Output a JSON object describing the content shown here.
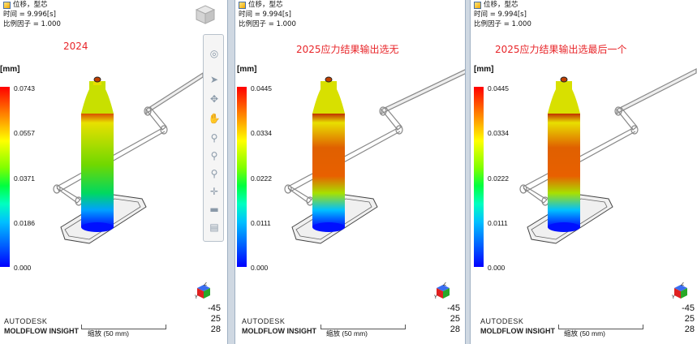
{
  "panels": [
    {
      "header": {
        "line1": "位移，型芯",
        "line2": "时间 = 9.996[s]",
        "line3": "比例因子 = 1.000"
      },
      "title": "2024",
      "unit": "[mm]",
      "legend_ticks": [
        "0.0743",
        "0.0557",
        "0.0371",
        "0.0186",
        "0.000"
      ],
      "coords": [
        "-45",
        "25",
        "28"
      ],
      "brand_line1": "AUTODESK",
      "brand_line2": "MOLDFLOW INSIGHT",
      "scale": "缩放 (50 mm)",
      "gradient": "green-model"
    },
    {
      "header": {
        "line1": "位移，型芯",
        "line2": "时间 = 9.994[s]",
        "line3": "比例因子 = 1.000"
      },
      "title": "2025应力结果输出选无",
      "unit": "[mm]",
      "legend_ticks": [
        "0.0445",
        "0.0334",
        "0.0222",
        "0.0111",
        "0.000"
      ],
      "coords": [
        "-45",
        "25",
        "28"
      ],
      "brand_line1": "AUTODESK",
      "brand_line2": "MOLDFLOW INSIGHT",
      "scale": "缩放 (50 mm)",
      "gradient": "orange-model"
    },
    {
      "header": {
        "line1": "位移，型芯",
        "line2": "时间 = 9.994[s]",
        "line3": "比例因子 = 1.000"
      },
      "title": "2025应力结果输出选最后一个",
      "unit": "[mm]",
      "legend_ticks": [
        "0.0445",
        "0.0334",
        "0.0222",
        "0.0111",
        "0.000"
      ],
      "coords": [
        "-45",
        "25",
        "28"
      ],
      "brand_line1": "AUTODESK",
      "brand_line2": "MOLDFLOW INSIGHT",
      "scale": "缩放 (50 mm)",
      "gradient": "orange-model"
    }
  ],
  "colors": {
    "title_red": "#e8262a",
    "legend_top": "#ff0000",
    "legend_bottom": "#0000ff"
  },
  "toolbar_icons": [
    "view-cube-icon",
    "orbit-icon",
    "select-arrow-icon",
    "pan-icon",
    "hand-icon",
    "zoom-icon",
    "zoom-fit-icon",
    "zoom-window-icon",
    "center-icon",
    "measure-icon",
    "results-icon"
  ]
}
